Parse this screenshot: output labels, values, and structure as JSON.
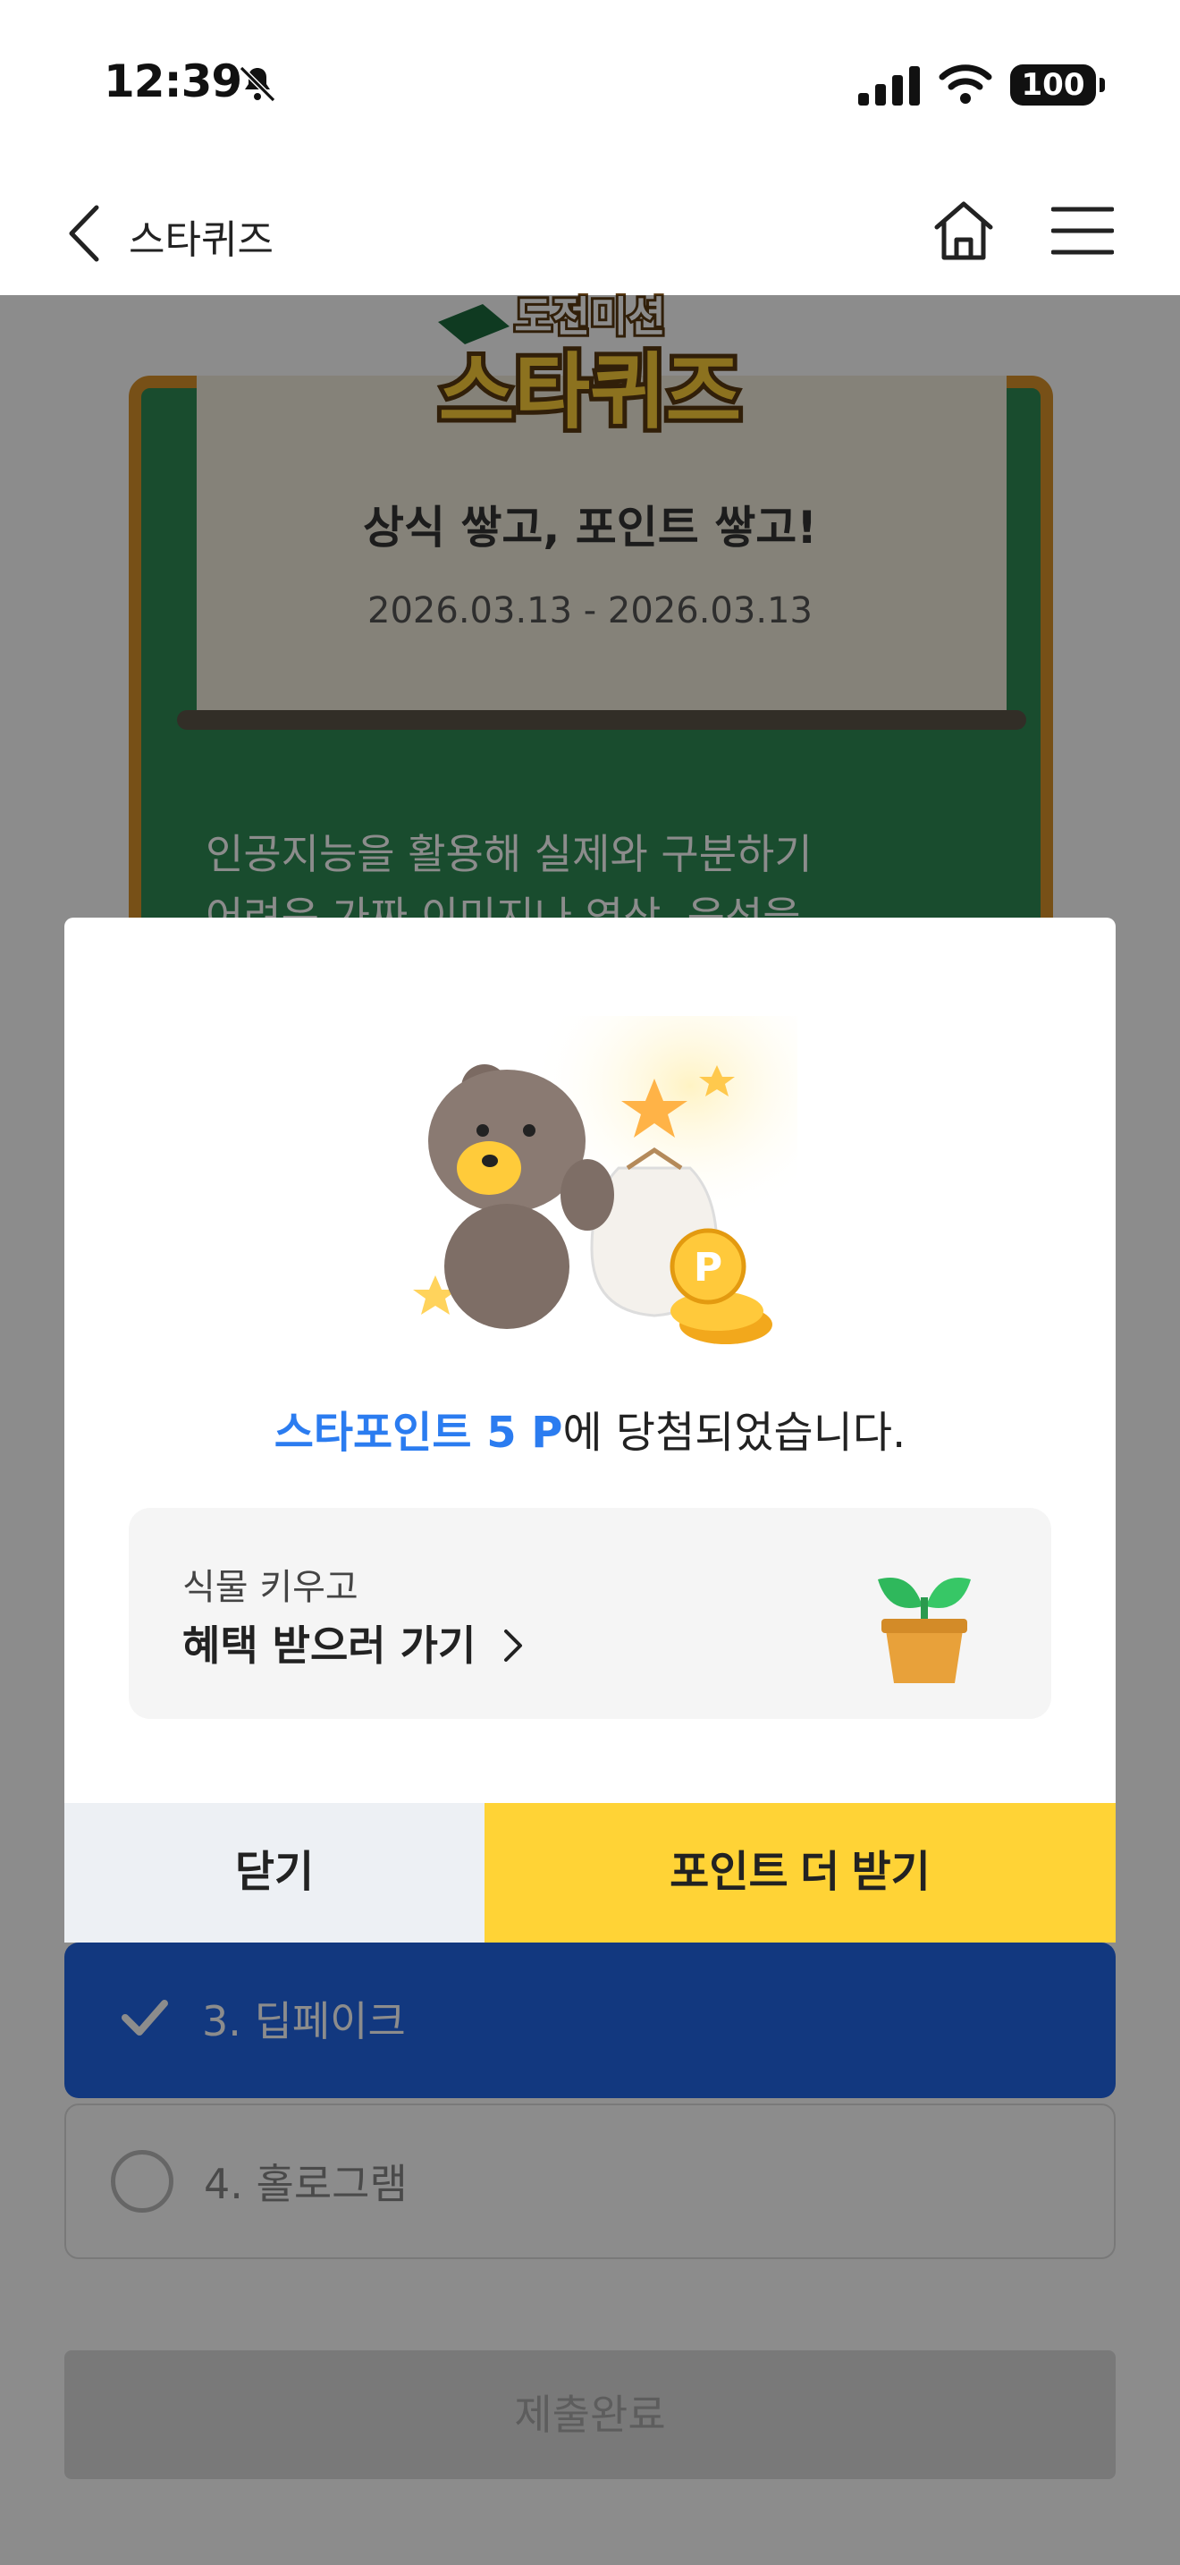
{
  "status_bar": {
    "time": "12:39",
    "battery": "100"
  },
  "header": {
    "title": "스타퀴즈"
  },
  "banner": {
    "logo_top": "도전미션",
    "logo_main": "스타퀴즈",
    "subtitle": "상식 쌓고, 포인트 쌓고!",
    "date_range": "2026.03.13 - 2026.03.13"
  },
  "quiz": {
    "description_line1": "인공지능을 활용해 실제와 구분하기",
    "description_line2": "어려운 가짜 이미지나 영상, 음성을",
    "options": [
      {
        "label": "3. 딥페이크",
        "selected": true
      },
      {
        "label": "4. 홀로그램",
        "selected": false
      }
    ],
    "submit_label": "제출완료"
  },
  "modal": {
    "message_highlight": "스타포인트 5 P",
    "message_rest": "에 당첨되었습니다.",
    "benefit_small": "식물 키우고",
    "benefit_main": "혜택 받으러 가기",
    "close_label": "닫기",
    "more_label": "포인트 더 받기"
  },
  "colors": {
    "accent_blue": "#2b7cf0",
    "button_yellow": "#ffd336",
    "board_green": "#2e8a55",
    "selected_option_blue": "#2266e8"
  },
  "icons": [
    "bell-slash-icon",
    "signal-icon",
    "wifi-icon",
    "back-chevron-icon",
    "home-icon",
    "menu-icon",
    "check-icon",
    "radio-icon",
    "chevron-right-icon",
    "plant-icon"
  ]
}
